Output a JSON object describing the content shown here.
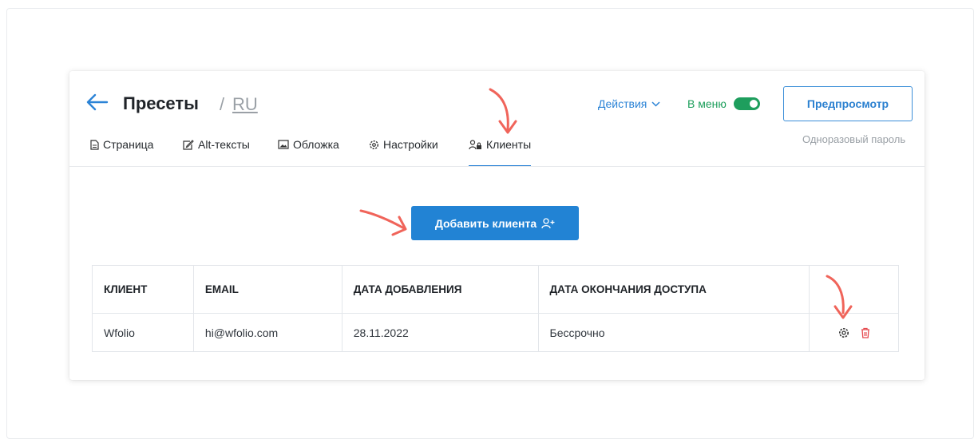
{
  "header": {
    "title": "Пресеты",
    "separator": "/",
    "lang": "RU",
    "actions_label": "Действия",
    "menu_label": "В меню",
    "menu_enabled": true,
    "preview_label": "Предпросмотр",
    "otp_label": "Одноразовый пароль"
  },
  "tabs": [
    {
      "label": "Страница",
      "icon": "page-icon"
    },
    {
      "label": "Alt-тексты",
      "icon": "edit-icon"
    },
    {
      "label": "Обложка",
      "icon": "image-icon"
    },
    {
      "label": "Настройки",
      "icon": "gear-icon"
    },
    {
      "label": "Клиенты",
      "icon": "users-lock-icon",
      "active": true
    }
  ],
  "main": {
    "add_client_label": "Добавить клиента"
  },
  "table": {
    "columns": [
      "КЛИЕНТ",
      "EMAIL",
      "ДАТА ДОБАВЛЕНИЯ",
      "ДАТА ОКОНЧАНИЯ ДОСТУПА"
    ],
    "rows": [
      {
        "client": "Wfolio",
        "email": "hi@wfolio.com",
        "added": "28.11.2022",
        "expires": "Бессрочно"
      }
    ]
  },
  "colors": {
    "accent": "#2283d4",
    "green": "#1e9e5d",
    "danger": "#e5484d",
    "annotation": "#f0645a"
  }
}
